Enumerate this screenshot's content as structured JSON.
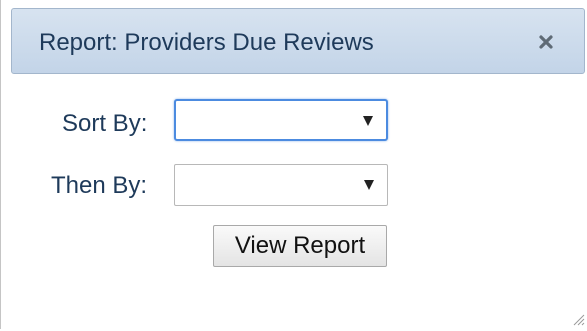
{
  "dialog": {
    "title": "Report: Providers Due Reviews",
    "close_icon": "close-icon"
  },
  "form": {
    "sort_by_label": "Sort By:",
    "sort_by_value": "",
    "then_by_label": "Then By:",
    "then_by_value": "",
    "view_report_label": "View Report"
  },
  "icons": {
    "dropdown": "chevron-down-icon",
    "resize": "resize-grip-icon"
  },
  "colors": {
    "titlebar": "#c9d8ea",
    "text": "#1e3a5a",
    "focus_border": "#4c8be0"
  }
}
